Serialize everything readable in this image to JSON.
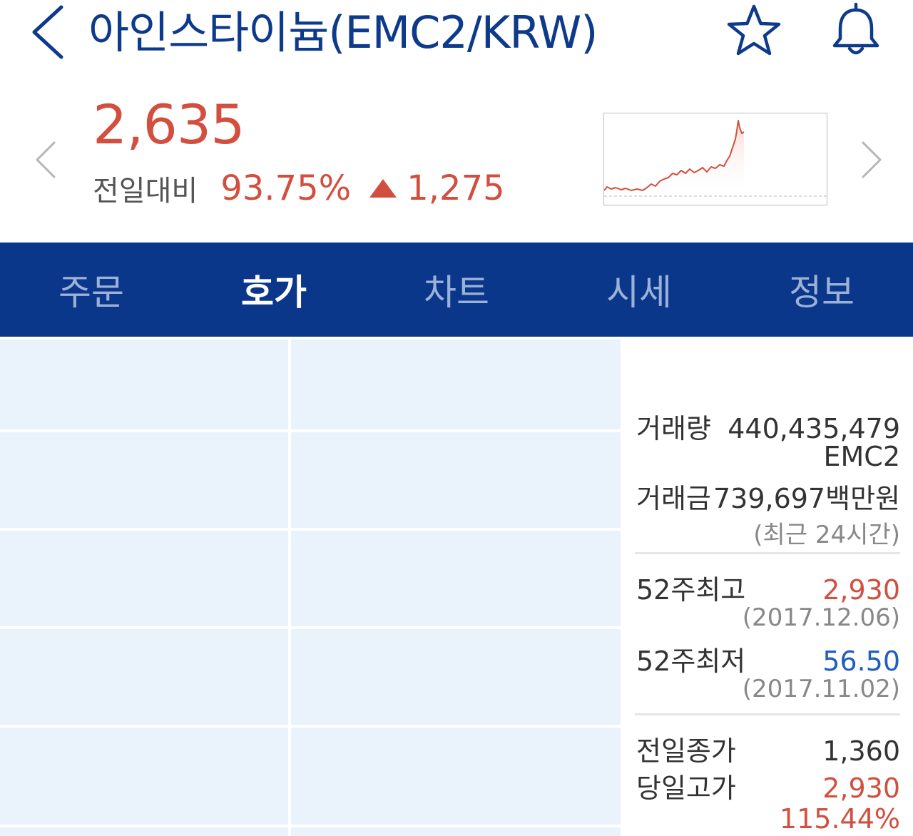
{
  "header": {
    "title": "아인스타이늄(EMC2/KRW)",
    "back_icon": "chevron-left-icon",
    "favorite_icon": "star-icon",
    "alert_icon": "bell-icon"
  },
  "price": {
    "current": "2,635",
    "change_label": "전일대비",
    "change_percent": "93.75%",
    "change_amount": "1,275",
    "direction": "up"
  },
  "tabs": [
    {
      "label": "주문",
      "active": false
    },
    {
      "label": "호가",
      "active": true
    },
    {
      "label": "차트",
      "active": false
    },
    {
      "label": "시세",
      "active": false
    },
    {
      "label": "정보",
      "active": false
    }
  ],
  "info": {
    "volume_label": "거래량",
    "volume_value": "440,435,479",
    "volume_unit": "EMC2",
    "amount_label": "거래금",
    "amount_value": "739,697백만원",
    "period_note": "(최근 24시간)",
    "high52_label": "52주최고",
    "high52_value": "2,930",
    "high52_date": "(2017.12.06)",
    "low52_label": "52주최저",
    "low52_value": "56.50",
    "low52_date": "(2017.11.02)",
    "prev_close_label": "전일종가",
    "prev_close_value": "1,360",
    "day_high_label": "당일고가",
    "day_high_value": "2,930",
    "day_high_pct": "115.44%"
  },
  "colors": {
    "brand": "#0a378a",
    "up": "#d24f3f",
    "down": "#1f5fb8",
    "orderbook_bg": "#eaf3fc"
  }
}
